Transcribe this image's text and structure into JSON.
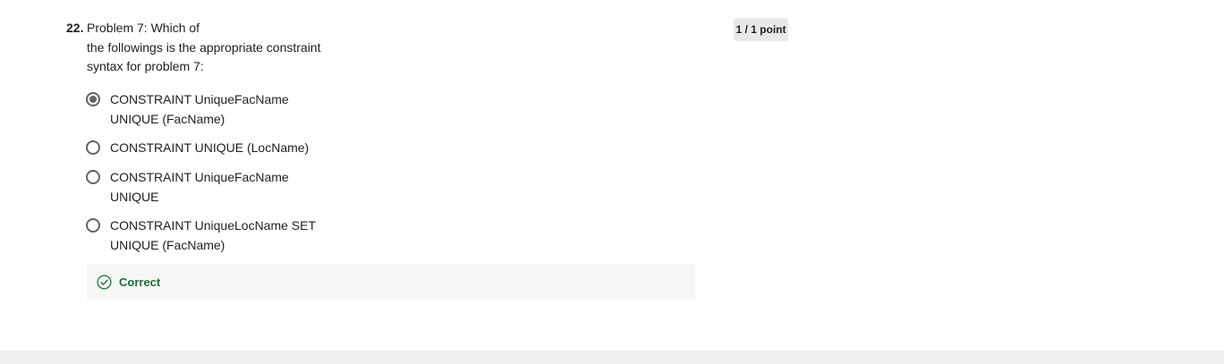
{
  "question": {
    "number": "22.",
    "text_lines": [
      "Problem 7: Which of",
      "the followings is the appropriate constraint",
      "syntax for problem 7:"
    ],
    "points": "1 / 1 point"
  },
  "options": [
    {
      "lines": [
        "CONSTRAINT UniqueFacName",
        "UNIQUE (FacName)"
      ],
      "selected": true
    },
    {
      "lines": [
        "CONSTRAINT UNIQUE (LocName)"
      ],
      "selected": false
    },
    {
      "lines": [
        "CONSTRAINT UniqueFacName",
        "UNIQUE"
      ],
      "selected": false
    },
    {
      "lines": [
        "CONSTRAINT UniqueLocName SET",
        "UNIQUE (FacName)"
      ],
      "selected": false
    }
  ],
  "feedback": {
    "label": "Correct",
    "icon": "check-circle-icon",
    "color": "#1e6b3a"
  },
  "colors": {
    "radio_border": "#636363",
    "feedback_bg": "#f5f7f5",
    "badge_bg": "#e8e8e8",
    "footer_bg": "#f0f0f0"
  }
}
